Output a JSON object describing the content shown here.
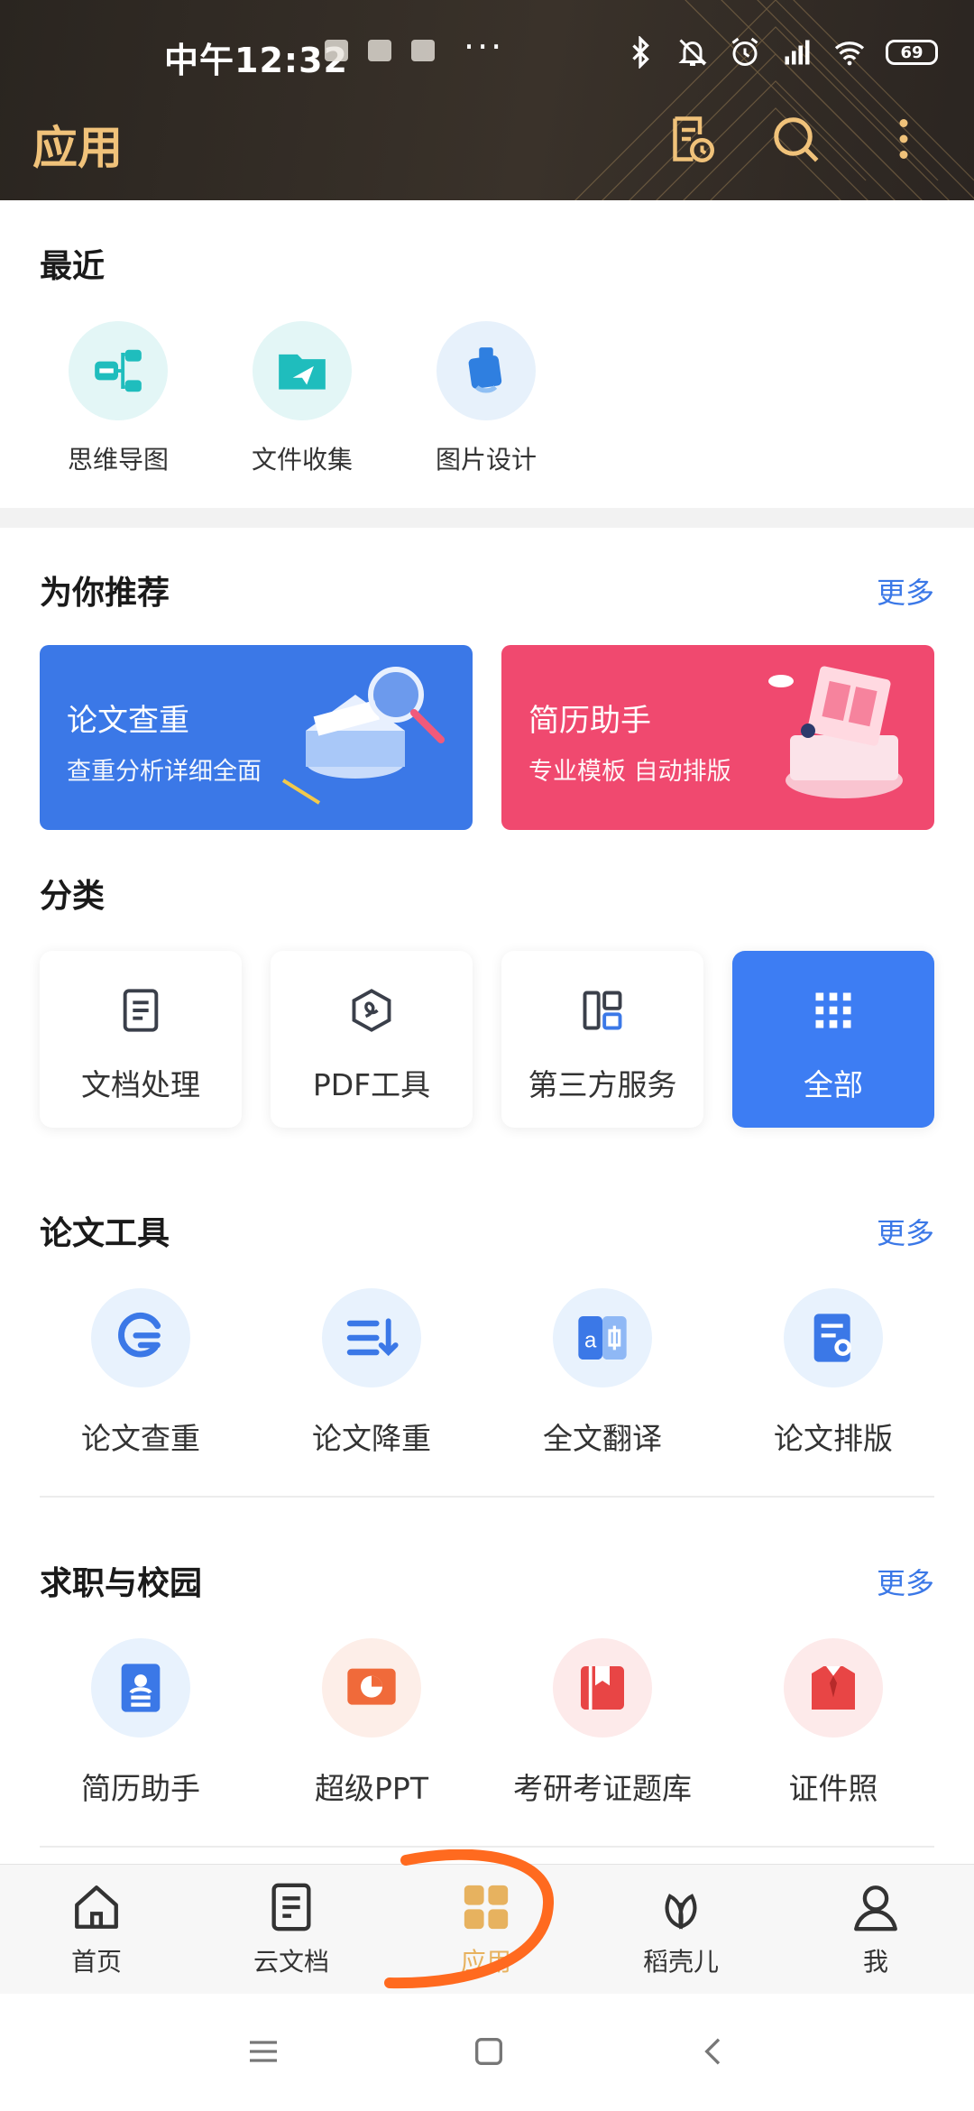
{
  "status": {
    "time": "中午12:32",
    "dots": "···",
    "battery": "69"
  },
  "header": {
    "title": "应用",
    "icons": [
      "file-history-icon",
      "search-icon",
      "more-vertical-icon"
    ]
  },
  "recent": {
    "title": "最近",
    "items": [
      {
        "label": "思维导图",
        "icon": "mindmap-icon",
        "bg": "#e3f6f6",
        "color": "#1fbdbd"
      },
      {
        "label": "文件收集",
        "icon": "folder-send-icon",
        "bg": "#e3f6f6",
        "color": "#1fbdbd"
      },
      {
        "label": "图片设计",
        "icon": "image-design-icon",
        "bg": "#e7f1fb",
        "color": "#2f7fe0"
      }
    ]
  },
  "recommend": {
    "title": "为你推荐",
    "more": "更多",
    "banners": [
      {
        "title": "论文查重",
        "subtitle": "查重分析详细全面",
        "color": "#3b78e7"
      },
      {
        "title": "简历助手",
        "subtitle": "专业模板 自动排版",
        "color": "#f0496f"
      }
    ]
  },
  "category": {
    "title": "分类",
    "items": [
      {
        "label": "文档处理",
        "icon": "document-icon"
      },
      {
        "label": "PDF工具",
        "icon": "pdf-icon"
      },
      {
        "label": "第三方服务",
        "icon": "layout-grid-icon"
      },
      {
        "label": "全部",
        "icon": "all-apps-icon"
      }
    ]
  },
  "paper_tools": {
    "title": "论文工具",
    "more": "更多",
    "items": [
      {
        "label": "论文查重",
        "icon": "plagiarism-check-icon"
      },
      {
        "label": "论文降重",
        "icon": "reduce-duplicate-icon"
      },
      {
        "label": "全文翻译",
        "icon": "translate-icon"
      },
      {
        "label": "论文排版",
        "icon": "paper-format-icon"
      }
    ]
  },
  "career_tools": {
    "title": "求职与校园",
    "more": "更多",
    "items": [
      {
        "label": "简历助手",
        "icon": "resume-icon"
      },
      {
        "label": "超级PPT",
        "icon": "ppt-icon"
      },
      {
        "label": "考研考证题库",
        "icon": "question-bank-icon"
      },
      {
        "label": "证件照",
        "icon": "id-photo-icon"
      }
    ]
  },
  "bottom_nav": {
    "items": [
      {
        "label": "首页",
        "icon": "home-icon"
      },
      {
        "label": "云文档",
        "icon": "cloud-doc-icon"
      },
      {
        "label": "应用",
        "icon": "apps-icon",
        "active": true
      },
      {
        "label": "稻壳儿",
        "icon": "leaf-icon"
      },
      {
        "label": "我",
        "icon": "profile-icon"
      }
    ]
  },
  "colors": {
    "accent_gold": "#f0c27a",
    "link_blue": "#3b78e7",
    "active_blue": "#3d7df3",
    "annotation_orange": "#ff6a1f"
  }
}
